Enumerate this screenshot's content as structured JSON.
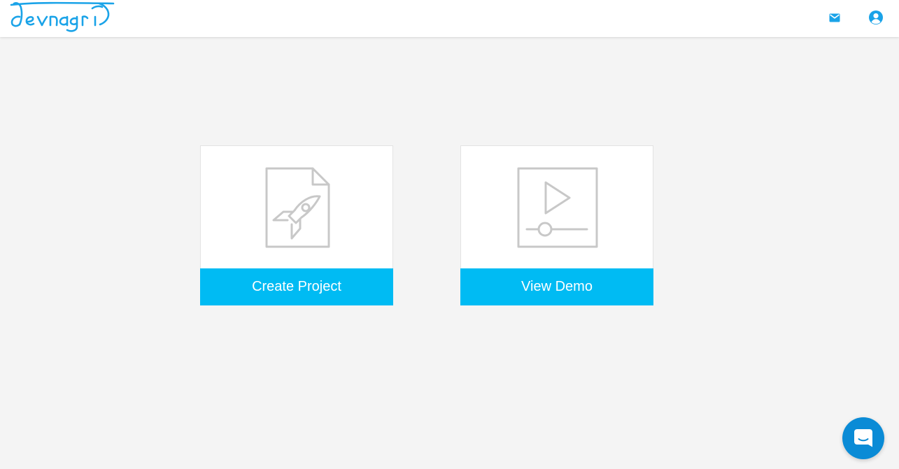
{
  "header": {
    "logo_text": "devnagri",
    "mail_icon": "mail-icon",
    "account_icon": "account-circle-icon"
  },
  "cards": {
    "create": {
      "label": "Create Project",
      "icon": "rocket-document-icon"
    },
    "demo": {
      "label": "View Demo",
      "icon": "video-player-icon"
    }
  },
  "chat": {
    "icon": "chat-bubble-icon"
  },
  "colors": {
    "brand": "#1aa3e8",
    "button": "#00bbf3",
    "background": "#f4f4f4",
    "icon_gray": "#c8c8c8",
    "chat": "#0a8bd6"
  }
}
